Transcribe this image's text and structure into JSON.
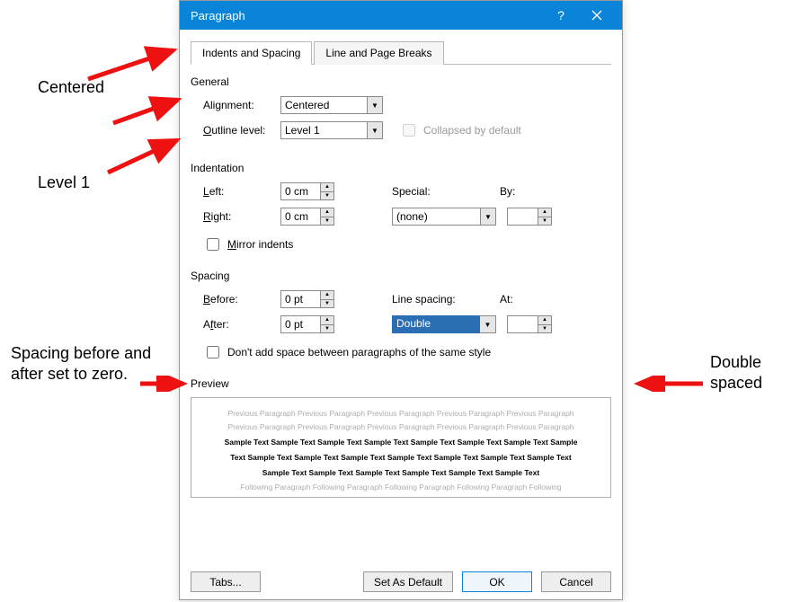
{
  "titlebar": {
    "title": "Paragraph"
  },
  "tabs": {
    "indents": "Indents and Spacing",
    "lines": "Line and Page Breaks"
  },
  "general": {
    "label": "General",
    "alignment_label": "Alignment:",
    "alignment_value": "Centered",
    "outline_label": "Outline level:",
    "outline_value": "Level 1",
    "collapsed_label": "Collapsed by default"
  },
  "indentation": {
    "label": "Indentation",
    "left_label": "Left:",
    "left_value": "0 cm",
    "right_label": "Right:",
    "right_value": "0 cm",
    "special_label": "Special:",
    "special_value": "(none)",
    "by_label": "By:",
    "by_value": "",
    "mirror_label": "Mirror indents"
  },
  "spacing": {
    "label": "Spacing",
    "before_label": "Before:",
    "before_value": "0 pt",
    "after_label": "After:",
    "after_value": "0 pt",
    "line_label": "Line spacing:",
    "line_value": "Double",
    "at_label": "At:",
    "at_value": "",
    "dontadd_label": "Don't add space between paragraphs of the same style"
  },
  "preview": {
    "label": "Preview",
    "prev_line": "Previous Paragraph Previous Paragraph Previous Paragraph Previous Paragraph Previous Paragraph",
    "sample1": "Sample Text Sample Text Sample Text Sample Text Sample Text Sample Text Sample Text Sample",
    "sample2": "Text Sample Text Sample Text Sample Text Sample Text Sample Text Sample Text Sample Text",
    "sample3": "Sample Text Sample Text Sample Text Sample Text Sample Text Sample Text",
    "follow_line": "Following Paragraph Following Paragraph Following Paragraph Following Paragraph Following"
  },
  "buttons": {
    "tabs": "Tabs...",
    "default": "Set As Default",
    "ok": "OK",
    "cancel": "Cancel"
  },
  "annotations": {
    "centered": "Centered",
    "level1": "Level 1",
    "spacing_zero": "Spacing before and after set to zero.",
    "double_spaced": "Double spaced"
  }
}
